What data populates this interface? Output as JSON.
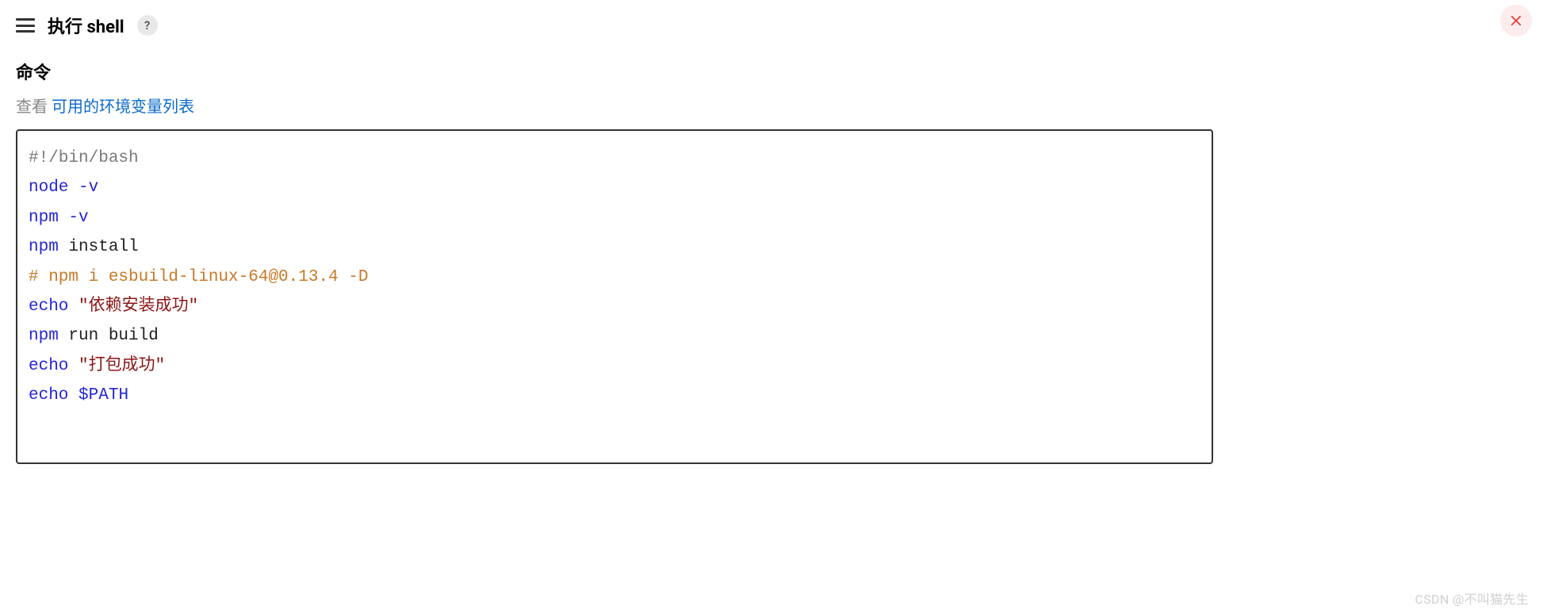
{
  "header": {
    "title": "执行 shell",
    "help_label": "?"
  },
  "field": {
    "label": "命令",
    "hint_prefix": "查看 ",
    "hint_link": "可用的环境变量列表"
  },
  "script": {
    "lines": [
      {
        "tokens": [
          {
            "cls": "tok-comment",
            "text": "#!/bin/bash"
          }
        ]
      },
      {
        "tokens": [
          {
            "cls": "tok-cmd",
            "text": "node"
          },
          {
            "cls": "tok-plain",
            "text": " "
          },
          {
            "cls": "tok-flag",
            "text": "-v"
          }
        ]
      },
      {
        "tokens": [
          {
            "cls": "tok-cmd",
            "text": "npm"
          },
          {
            "cls": "tok-plain",
            "text": " "
          },
          {
            "cls": "tok-flag",
            "text": "-v"
          }
        ]
      },
      {
        "tokens": [
          {
            "cls": "tok-cmd",
            "text": "npm"
          },
          {
            "cls": "tok-plain",
            "text": " install"
          }
        ]
      },
      {
        "tokens": [
          {
            "cls": "tok-comment-orange",
            "text": "# npm i esbuild-linux-64@0.13.4 -D"
          }
        ]
      },
      {
        "tokens": [
          {
            "cls": "tok-cmd",
            "text": "echo"
          },
          {
            "cls": "tok-plain",
            "text": " "
          },
          {
            "cls": "tok-string",
            "text": "\"依赖安装成功\""
          }
        ]
      },
      {
        "tokens": [
          {
            "cls": "tok-cmd",
            "text": "npm"
          },
          {
            "cls": "tok-plain",
            "text": " run build"
          }
        ]
      },
      {
        "tokens": [
          {
            "cls": "tok-cmd",
            "text": "echo"
          },
          {
            "cls": "tok-plain",
            "text": " "
          },
          {
            "cls": "tok-string",
            "text": "\"打包成功\""
          }
        ]
      },
      {
        "tokens": [
          {
            "cls": "tok-cmd",
            "text": "echo"
          },
          {
            "cls": "tok-plain",
            "text": " "
          },
          {
            "cls": "tok-var",
            "text": "$PATH"
          }
        ]
      }
    ]
  },
  "watermark": "CSDN @不叫猫先生"
}
